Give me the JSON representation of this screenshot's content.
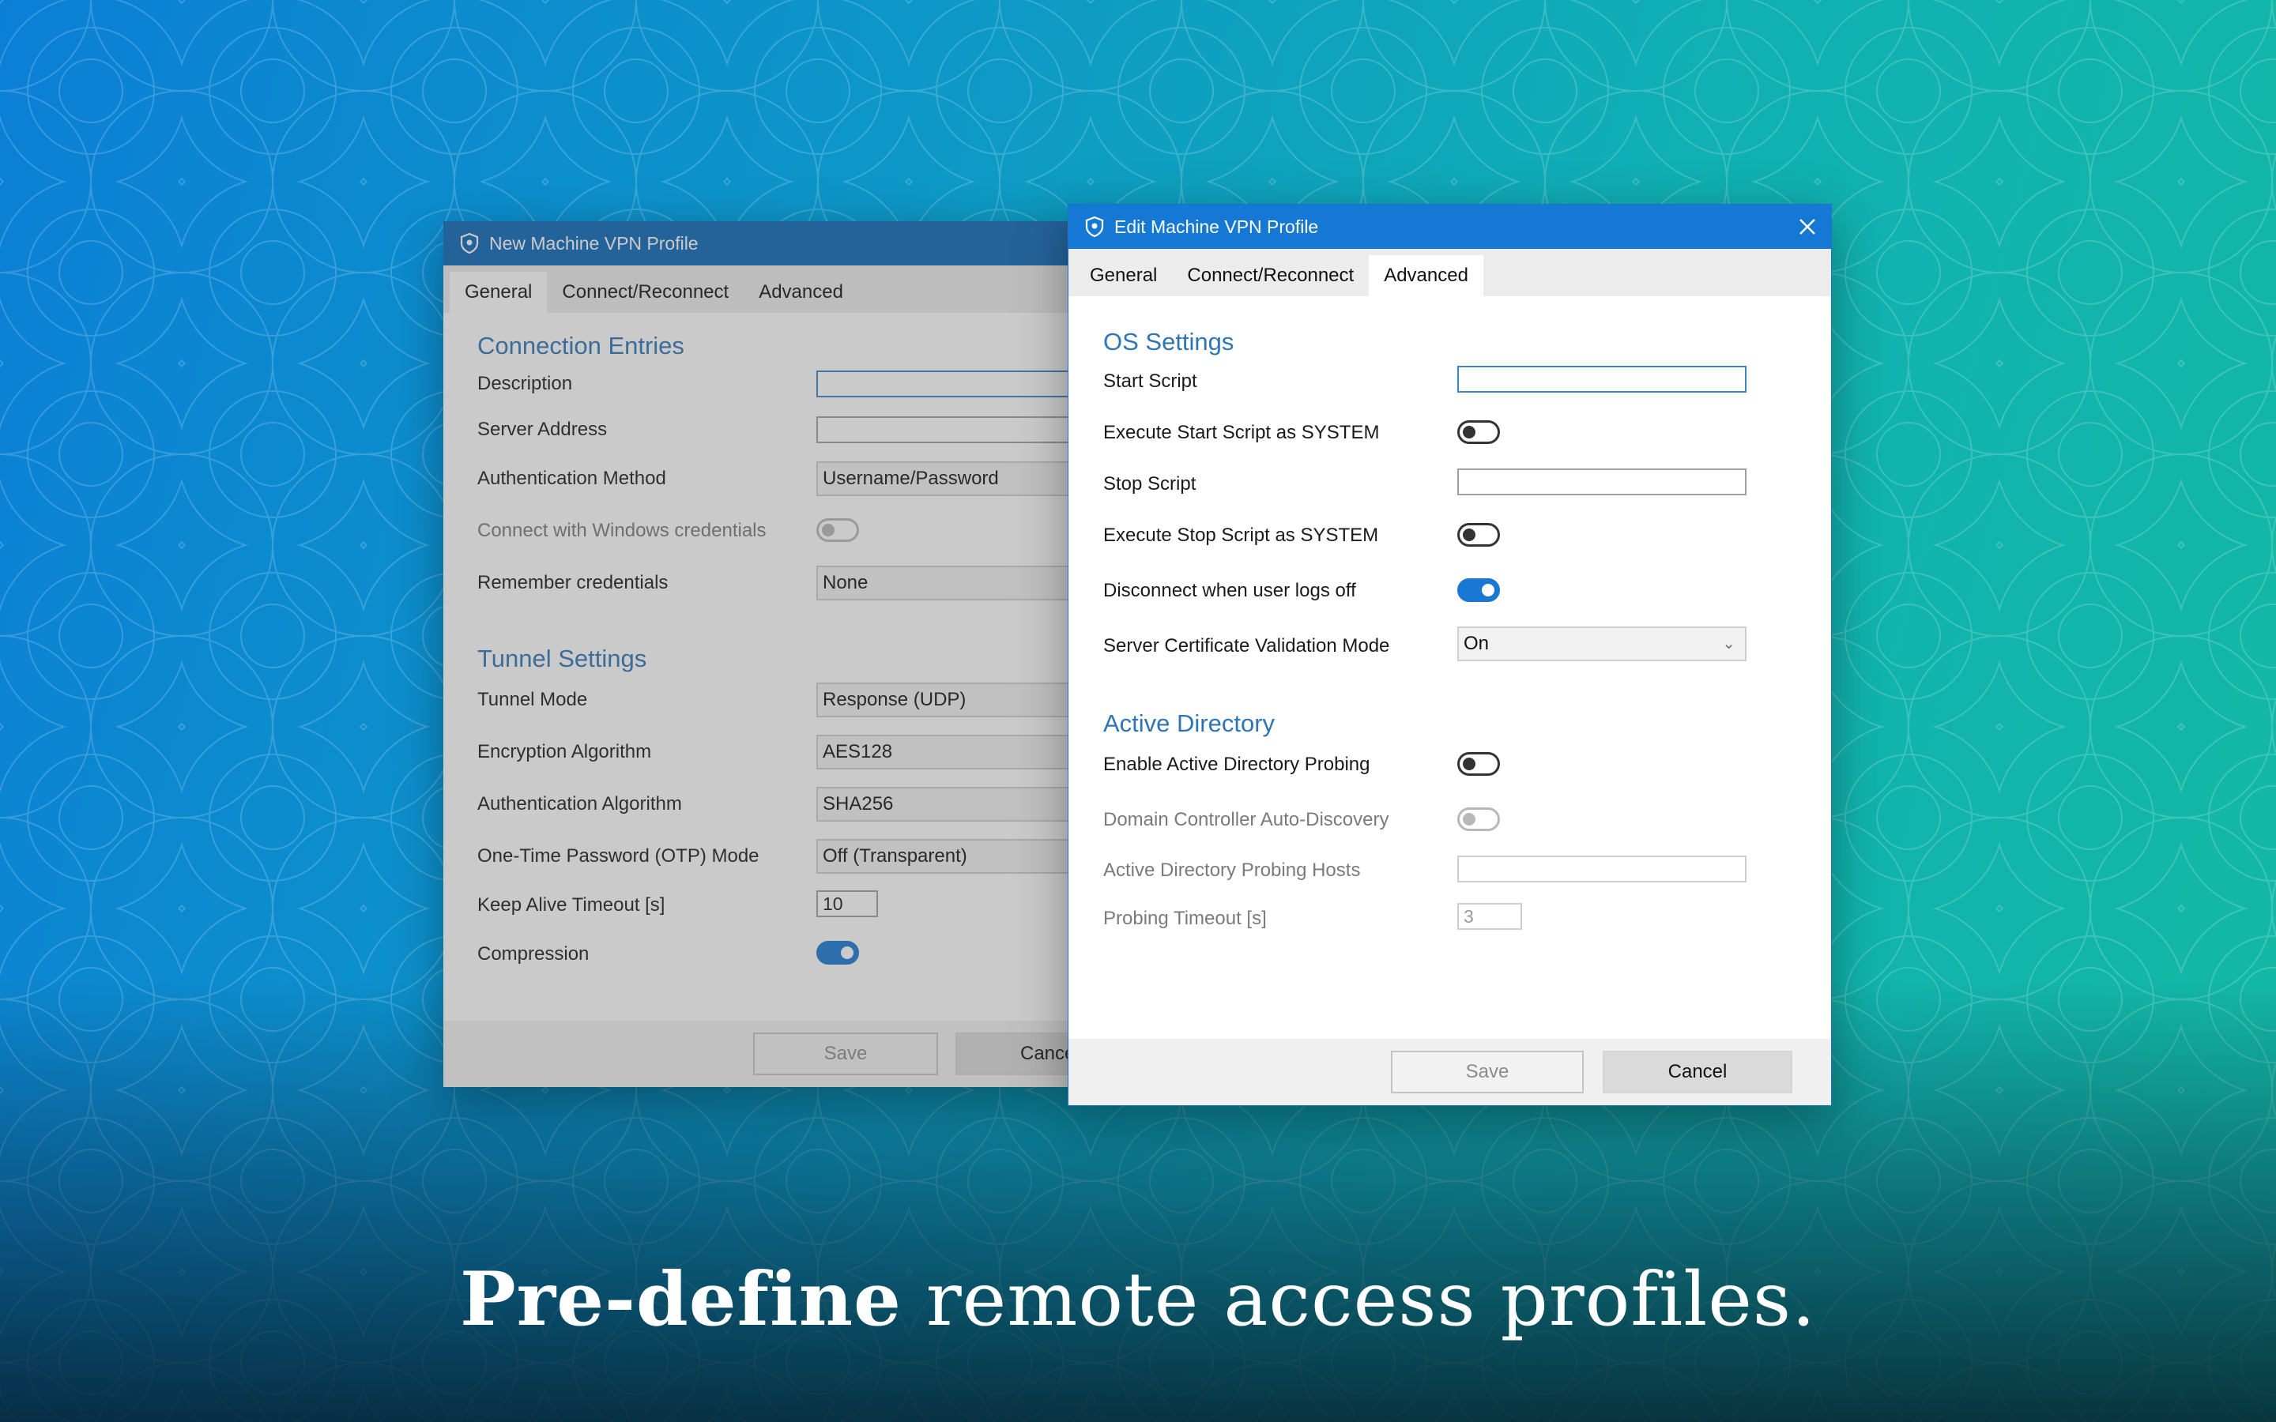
{
  "back_window": {
    "title": "New Machine VPN Profile",
    "tabs": [
      {
        "label": "General",
        "active": true
      },
      {
        "label": "Connect/Reconnect",
        "active": false
      },
      {
        "label": "Advanced",
        "active": false
      }
    ],
    "sections": {
      "connection_title": "Connection Entries",
      "tunnel_title": "Tunnel Settings"
    },
    "fields": {
      "description_label": "Description",
      "description_value": "",
      "server_address_label": "Server Address",
      "server_address_value": "",
      "auth_method_label": "Authentication Method",
      "auth_method_value": "Username/Password",
      "windows_credentials_label": "Connect with Windows credentials",
      "windows_credentials_on": false,
      "remember_label": "Remember credentials",
      "remember_value": "None",
      "tunnel_mode_label": "Tunnel Mode",
      "tunnel_mode_value": "Response (UDP)",
      "encryption_label": "Encryption Algorithm",
      "encryption_value": "AES128",
      "auth_algo_label": "Authentication Algorithm",
      "auth_algo_value": "SHA256",
      "otp_label": "One-Time Password (OTP) Mode",
      "otp_value": "Off (Transparent)",
      "keepalive_label": "Keep Alive Timeout [s]",
      "keepalive_value": "10",
      "compression_label": "Compression",
      "compression_on": true
    },
    "buttons": {
      "save": "Save",
      "cancel": "Cance"
    }
  },
  "front_window": {
    "title": "Edit Machine VPN Profile",
    "tabs": [
      {
        "label": "General",
        "active": false
      },
      {
        "label": "Connect/Reconnect",
        "active": false
      },
      {
        "label": "Advanced",
        "active": true
      }
    ],
    "sections": {
      "os_title": "OS Settings",
      "ad_title": "Active Directory"
    },
    "fields": {
      "start_script_label": "Start Script",
      "start_script_value": "",
      "exec_start_label": "Execute Start Script as SYSTEM",
      "exec_start_on": false,
      "stop_script_label": "Stop Script",
      "stop_script_value": "",
      "exec_stop_label": "Execute Stop Script as SYSTEM",
      "exec_stop_on": false,
      "disconnect_label": "Disconnect when user logs off",
      "disconnect_on": true,
      "cert_mode_label": "Server Certificate Validation Mode",
      "cert_mode_value": "On",
      "ad_probing_label": "Enable Active Directory Probing",
      "ad_probing_on": false,
      "dc_discovery_label": "Domain Controller Auto-Discovery",
      "dc_discovery_on": false,
      "probing_hosts_label": "Active Directory Probing Hosts",
      "probing_hosts_value": "",
      "probing_timeout_label": "Probing Timeout [s]",
      "probing_timeout_value": "3"
    },
    "buttons": {
      "save": "Save",
      "cancel": "Cancel"
    }
  },
  "tagline": {
    "bold": "Pre-define",
    "rest": " remote access profiles."
  },
  "colors": {
    "titlebar_blue": "#1478d4",
    "section_blue": "#2e75b6",
    "toggle_on": "#1878d4"
  },
  "icons": {
    "app": "vpn-shield-icon",
    "close": "close-icon",
    "dropdown": "chevron-down-icon"
  }
}
